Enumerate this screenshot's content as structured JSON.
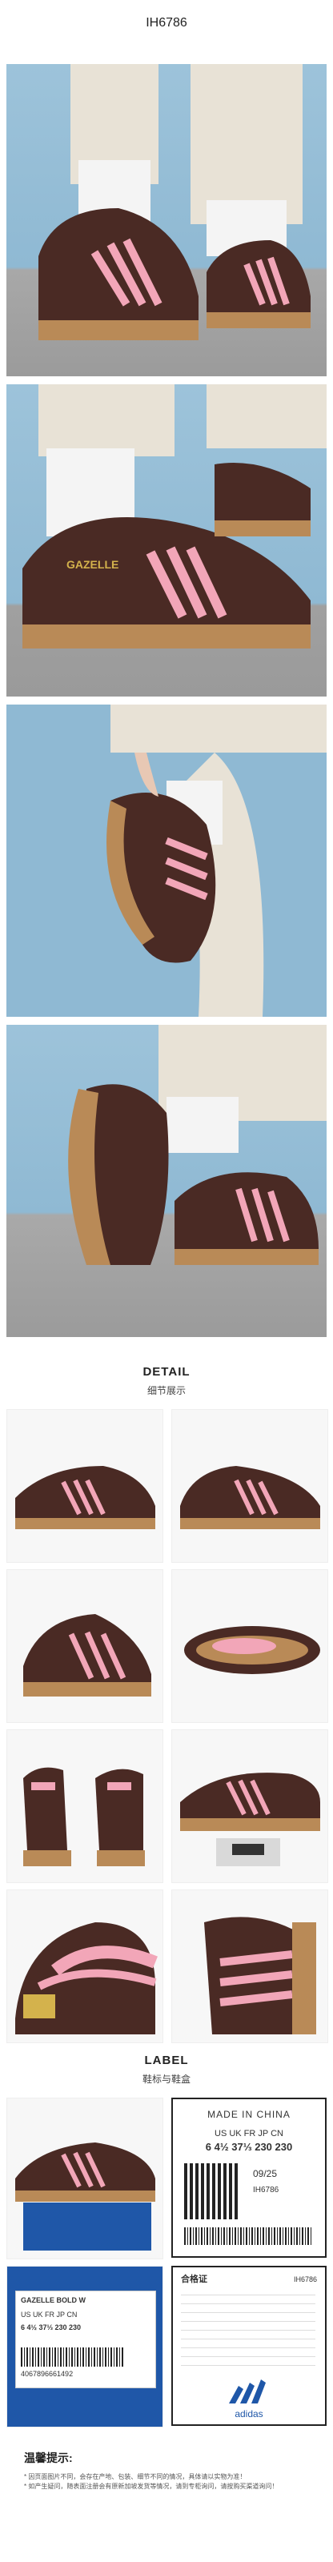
{
  "header": {
    "model_code": "IH6786"
  },
  "detail_section": {
    "title_en": "DETAIL",
    "title_cn": "细节展示"
  },
  "label_section": {
    "title_en": "LABEL",
    "title_cn": "鞋标与鞋盒"
  },
  "shoe": {
    "tongue_text": "GAZELLE",
    "brand_text": "adidas"
  },
  "box_label": {
    "made_in": "MADE IN CHINA",
    "size_header": "US  UK  FR  JP  CN",
    "size_values": "6  4½ 37⅓ 230 230",
    "date": "09/25",
    "article_code": "IH6786",
    "product_name": "GAZELLE BOLD W",
    "qualified": "合格证",
    "barcode_digits": "4067896661492"
  },
  "hint": {
    "title": "温馨提示:",
    "line1": "* 因页面图片不同，会存在产地、包装、细节不同的情况，具体请以实物为准！",
    "line2": "* 如产生疑问，随表面注册会有原新加坡发货等情况，请到专柜询问，请按购买渠道询问！"
  },
  "colors": {
    "brown": "#4a2a24",
    "pink": "#f2a6b8",
    "gum": "#b98a57",
    "sky": "#8fb9d3"
  }
}
